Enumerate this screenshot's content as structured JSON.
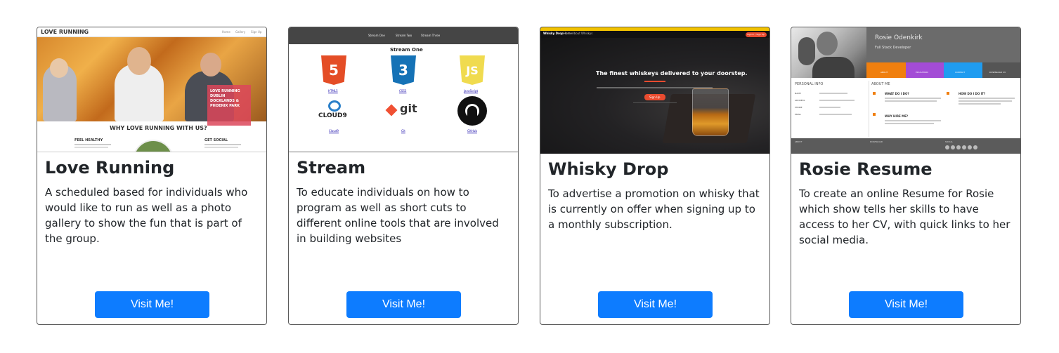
{
  "cards": [
    {
      "title": "Love Running",
      "description": "A scheduled based for individuals who would like to run as well as a photo gallery to show the fun that is part of the group.",
      "button_label": "Visit Me!",
      "thumb": {
        "brand": "LOVE RUNNING",
        "nav": [
          "Home",
          "Gallery",
          "Sign Up"
        ],
        "hero_text": "LOVE RUNNING DUBLIN DOCKLANDS & PHOENIX PARK",
        "section_title": "WHY LOVE RUNNING WITH US?",
        "left_heading": "FEEL HEALTHY",
        "right_heading": "GET SOCIAL"
      }
    },
    {
      "title": "Stream",
      "description": "To educate individuals on how to program as well as short cuts to different online tools that are involved in building websites",
      "button_label": "Visit Me!",
      "thumb": {
        "nav": [
          "Stream One",
          "Stream Two",
          "Stream Three"
        ],
        "heading": "Stream One",
        "tiles": [
          {
            "label": "HTML5",
            "logo": "5",
            "icon": "html5-icon"
          },
          {
            "label": "CSS3",
            "logo": "3",
            "icon": "css3-icon"
          },
          {
            "label": "JavaScript",
            "logo": "JS",
            "icon": "javascript-icon"
          },
          {
            "label": "Cloud9",
            "logo": "CLOUD9",
            "icon": "cloud9-icon"
          },
          {
            "label": "Git",
            "logo": "git",
            "icon": "git-icon"
          },
          {
            "label": "GitHub",
            "logo": "",
            "icon": "github-icon"
          }
        ]
      }
    },
    {
      "title": "Whisky Drop",
      "description": "To advertise a promotion on whisky that is currently on offer when signing up to a monthly subscription.",
      "button_label": "Visit Me!",
      "thumb": {
        "brand": "Whisky Drop",
        "nav": [
          "Home",
          "About",
          "Whiskys"
        ],
        "signup": "Sign In / Sign Up",
        "headline": "The finest whiskeys delivered to your doorstep.",
        "cta": "Sign Up"
      }
    },
    {
      "title": "Rosie Resume",
      "description": "To create an online Resume for Rosie which show tells her skills to have access to her CV, with quick links to her social media.",
      "button_label": "Visit Me!",
      "thumb": {
        "name": "Rosie Odenkirk",
        "role": "Full Stack Developer",
        "tabs": [
          "ABOUT",
          "EDUCATION",
          "CONTACT",
          "DOWNLOAD CV"
        ],
        "left_title": "PERSONAL INFO",
        "right_title": "ABOUT ME",
        "info_labels": [
          "NAME",
          "ADDRESS",
          "PHONE",
          "EMAIL"
        ],
        "q1": "WHAT DO I DO?",
        "q2": "HOW DO I DO IT?",
        "q3": "WHY HIRE ME?",
        "footer": [
          "ABOUT",
          "DOWNLOAD",
          "SOCIAL"
        ]
      }
    }
  ],
  "colors": {
    "button": "#0d7cff",
    "html5": "#e44d26",
    "css3": "#1572b6",
    "js": "#f0db4f",
    "whisky_accent": "#e94b2f",
    "rosie_tabs": [
      "#f07f0e",
      "#a34cd6",
      "#1f9cf0",
      "#555555"
    ]
  }
}
